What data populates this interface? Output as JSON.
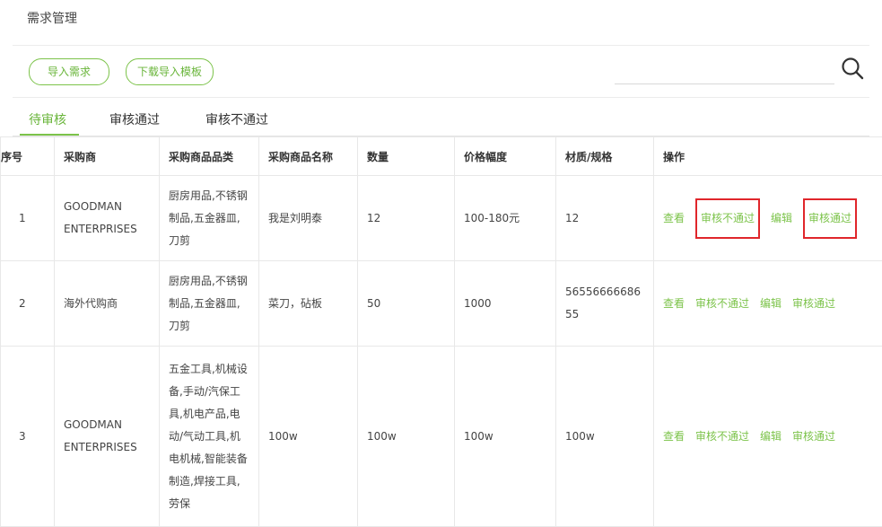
{
  "header": {
    "title": "需求管理"
  },
  "toolbar": {
    "import_label": "导入需求",
    "download_template_label": "下载导入模板"
  },
  "search": {
    "placeholder": ""
  },
  "tabs": [
    {
      "label": "待审核",
      "active": true
    },
    {
      "label": "审核通过",
      "active": false
    },
    {
      "label": "审核不通过",
      "active": false
    }
  ],
  "table": {
    "columns": [
      "序号",
      "采购商",
      "采购商品品类",
      "采购商品名称",
      "数量",
      "价格幅度",
      "材质/规格",
      "操作"
    ],
    "rows": [
      {
        "index": "1",
        "buyer": "GOODMAN ENTERPRISES",
        "category": "厨房用品,不锈钢制品,五金器皿,刀剪",
        "name": "我是刘明泰",
        "qty": "12",
        "price": "100-180元",
        "spec": "12"
      },
      {
        "index": "2",
        "buyer": "海外代购商",
        "category": "厨房用品,不锈钢制品,五金器皿,刀剪",
        "name": "菜刀，砧板",
        "qty": "50",
        "price": "1000",
        "spec": "5655666668655"
      },
      {
        "index": "3",
        "buyer": "GOODMAN ENTERPRISES",
        "category": "五金工具,机械设备,手动/汽保工具,机电产品,电动/气动工具,机电机械,智能装备制造,焊接工具,劳保",
        "name": "100w",
        "qty": "100w",
        "price": "100w",
        "spec": "100w"
      }
    ],
    "actions": {
      "view": "查看",
      "reject": "审核不通过",
      "edit": "编辑",
      "approve": "审核通过"
    }
  },
  "colors": {
    "accent": "#7cc34a",
    "highlight_box": "#e0262b"
  }
}
